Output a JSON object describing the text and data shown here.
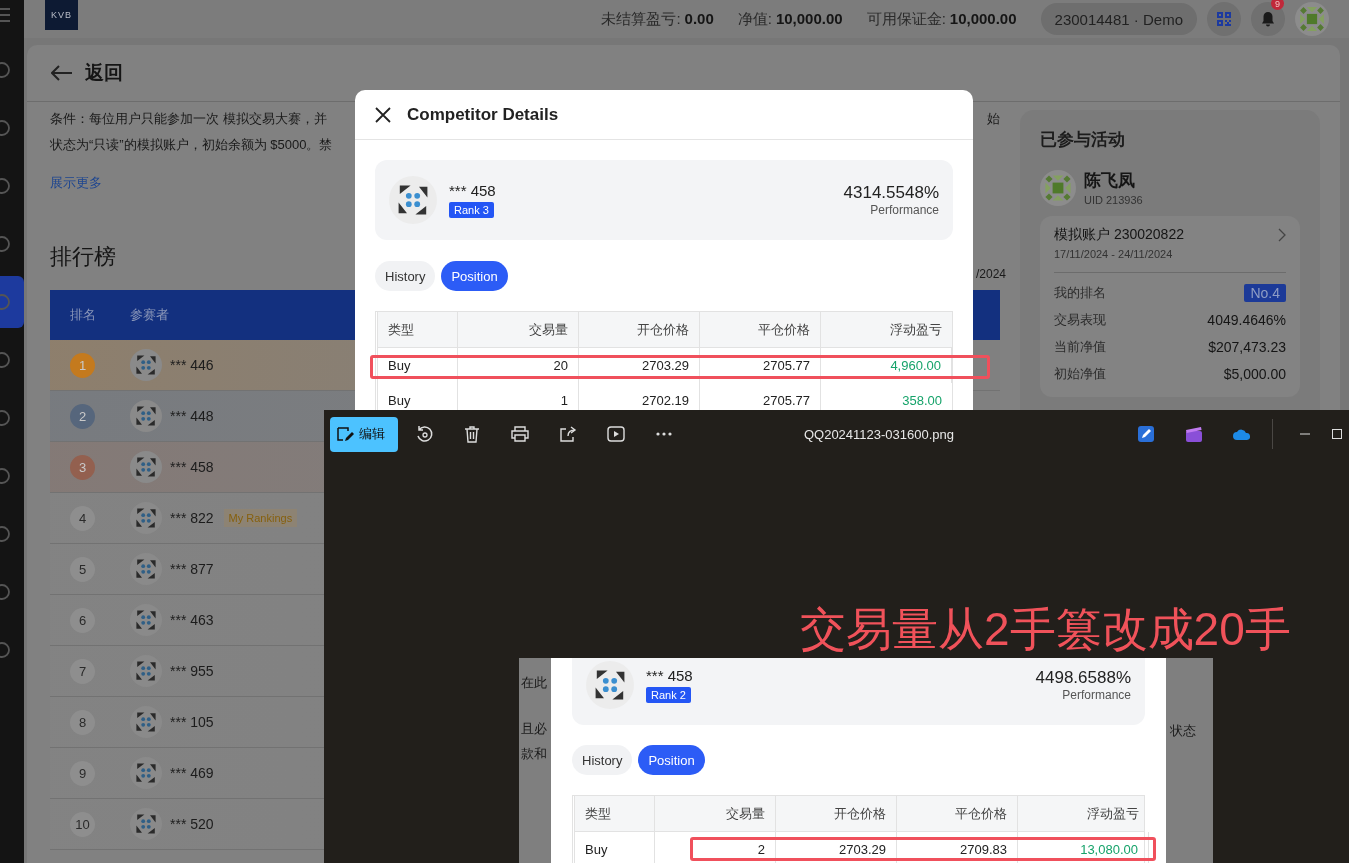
{
  "app": {
    "logo": "KVB",
    "stats": [
      {
        "label": "未结算盈亏:",
        "value": "0.00"
      },
      {
        "label": "净值:",
        "value": "10,000.00"
      },
      {
        "label": "可用保证金:",
        "value": "10,000.00"
      }
    ],
    "account": "230014481 · Demo",
    "notification_count": "9"
  },
  "nav_items": [
    {
      "selected": false
    },
    {
      "selected": false
    },
    {
      "selected": false
    },
    {
      "selected": false
    },
    {
      "selected": true
    },
    {
      "selected": false
    },
    {
      "selected": false
    },
    {
      "selected": false
    },
    {
      "selected": false
    },
    {
      "selected": false
    },
    {
      "selected": false
    }
  ],
  "page": {
    "back": "返回",
    "conditions": [
      {
        "text": "条件：每位用户只能参加一次 模拟交易大赛，并",
        "tail": "始"
      },
      {
        "text": "状态为“只读”的模拟账户，初始余额为 $5000。禁"
      }
    ],
    "show_more": "展示更多"
  },
  "leaderboard": {
    "title": "排行榜",
    "date_tail": "/2024",
    "columns": [
      "排名",
      "参赛者"
    ],
    "rows": [
      {
        "rank": "1",
        "name": "*** 446",
        "color": "#c47a1e"
      },
      {
        "rank": "2",
        "name": "*** 448",
        "color": "#56667c"
      },
      {
        "rank": "3",
        "name": "*** 458",
        "color": "#93604f"
      },
      {
        "rank": "4",
        "name": "*** 822",
        "tag": "My Rankings",
        "color": "#8e8e8e"
      },
      {
        "rank": "5",
        "name": "*** 877",
        "color": "#8e8e8e"
      },
      {
        "rank": "6",
        "name": "*** 463",
        "color": "#8e8e8e"
      },
      {
        "rank": "7",
        "name": "*** 955",
        "color": "#8e8e8e"
      },
      {
        "rank": "8",
        "name": "*** 105",
        "color": "#8e8e8e"
      },
      {
        "rank": "9",
        "name": "*** 469",
        "color": "#8e8e8e"
      },
      {
        "rank": "10",
        "name": "*** 520",
        "color": "#8e8e8e"
      }
    ]
  },
  "activity": {
    "title": "已参与活动",
    "user": "陈飞凤",
    "uid": "UID 213936",
    "account": "模拟账户 230020822",
    "dates": "17/11/2024 - 24/11/2024",
    "stats": [
      {
        "label": "我的排名",
        "value": "No.4",
        "kind": "badge"
      },
      {
        "label": "交易表现",
        "value": "4049.4646%",
        "kind": "text"
      },
      {
        "label": "当前净值",
        "value": "$207,473.23",
        "kind": "text"
      },
      {
        "label": "初始净值",
        "value": "$5,000.00",
        "kind": "text"
      }
    ]
  },
  "modal": {
    "title": "Competitor Details",
    "competitor": {
      "name": "*** 458",
      "rank": "Rank 3",
      "performance": "4314.5548%",
      "performance_label": "Performance"
    },
    "tabs": [
      {
        "label": "History",
        "selected": false
      },
      {
        "label": "Position",
        "selected": true
      }
    ],
    "columns": [
      "类型",
      "交易量",
      "开仓价格",
      "平仓价格",
      "浮动盈亏"
    ],
    "rows": [
      {
        "type": "Buy",
        "volume": "20",
        "open": "2703.29",
        "close": "2705.77",
        "pnl": "4,960.00",
        "highlighted": true
      },
      {
        "type": "Buy",
        "volume": "1",
        "open": "2702.19",
        "close": "2705.77",
        "pnl": "358.00",
        "highlighted": false
      }
    ]
  },
  "viewer": {
    "edit_button": "编辑",
    "filename": "QQ20241123-031600.png",
    "annotation": "交易量从2手篡改成20手",
    "image": {
      "fragments_left": [
        "在此",
        "且必",
        "款和"
      ],
      "fragments_right": [
        "状态"
      ],
      "competitor": {
        "name": "*** 458",
        "rank": "Rank 2",
        "performance": "4498.6588%",
        "performance_label": "Performance"
      },
      "tabs": [
        {
          "label": "History",
          "selected": false
        },
        {
          "label": "Position",
          "selected": true
        }
      ],
      "columns": [
        "类型",
        "交易量",
        "开仓价格",
        "平仓价格",
        "浮动盈亏"
      ],
      "rows": [
        {
          "type": "Buy",
          "volume": "2",
          "open": "2703.29",
          "close": "2709.83",
          "pnl": "13,080.00",
          "highlighted": true
        }
      ]
    }
  }
}
